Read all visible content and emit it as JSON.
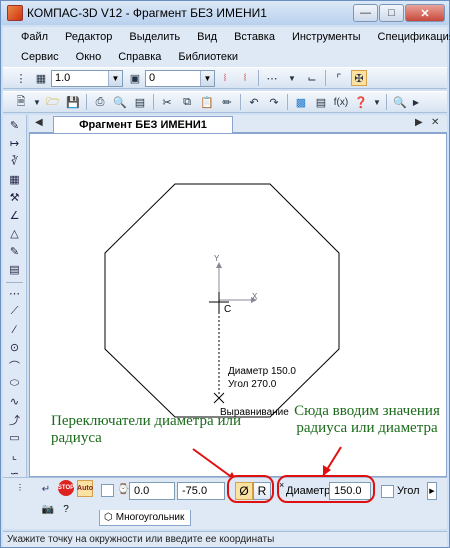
{
  "window": {
    "title": "КОМПАС-3D V12 - Фрагмент БЕЗ ИМЕНИ1"
  },
  "menu": {
    "row1": [
      "Файл",
      "Редактор",
      "Выделить",
      "Вид",
      "Вставка",
      "Инструменты",
      "Спецификация"
    ],
    "row2": [
      "Сервис",
      "Окно",
      "Справка",
      "Библиотеки"
    ]
  },
  "toolbar1": {
    "scale_value": "1.0",
    "layer_value": "0"
  },
  "document": {
    "tab_title": "Фрагмент БЕЗ ИМЕНИ1"
  },
  "canvas": {
    "axis_y": "Y",
    "axis_x": "X",
    "center_label": "C",
    "tooltip_diameter": "Диаметр 150.0",
    "tooltip_angle": "Угол   270.0",
    "tooltip_align": "Выравнивание"
  },
  "properties": {
    "point_x": "0.0",
    "point_y": "-75.0",
    "diameter_btn": "Ø",
    "radius_btn": "R",
    "diameter_label": "Диаметр",
    "diameter_value": "150.0",
    "angle_label": "Угол",
    "tab_label": "Многоугольник",
    "auto_label": "Auto",
    "stop_label": "STOP"
  },
  "status": {
    "text": "Укажите точку на окружности или введите ее координаты"
  },
  "annotations": {
    "left": "Переключатели диаметра или радиуса",
    "right": "Сюда вводим значения радиуса или диаметра"
  },
  "colors": {
    "annotation": "#1a6a1a",
    "highlight": "#e01010"
  }
}
